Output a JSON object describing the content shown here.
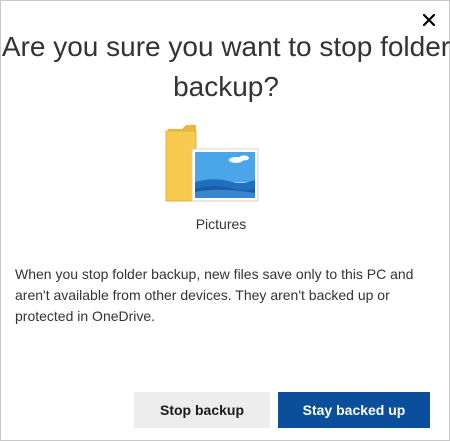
{
  "dialog": {
    "title": "Are you sure you want to stop folder backup?",
    "close_icon": "close-icon",
    "folder": {
      "icon": "pictures-folder-icon",
      "label": "Pictures"
    },
    "description": "When you stop folder backup, new files save only to this PC and aren't available from other devices. They aren't backed up or protected in OneDrive.",
    "buttons": {
      "secondary_label": "Stop backup",
      "primary_label": "Stay backed up"
    },
    "colors": {
      "primary_button": "#0a4e9c",
      "secondary_button": "#ededed",
      "folder": "#f7c94f",
      "photo_sky": "#4aa6e8",
      "photo_water": "#1f6fc0"
    }
  }
}
